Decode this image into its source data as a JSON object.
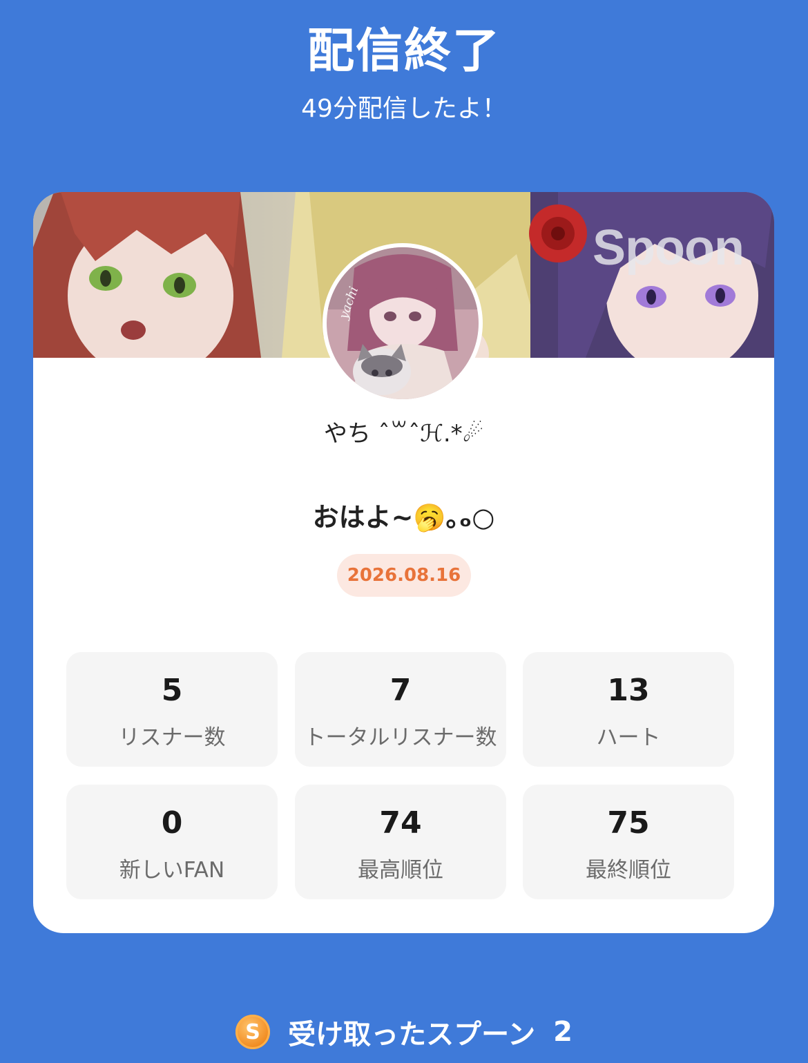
{
  "header": {
    "title": "配信終了",
    "subtitle": "49分配信したよ！"
  },
  "card": {
    "banner_watermark": "Spoon",
    "avatar_signature": "yachi",
    "username": "やち ˆ꒳ˆℋ.*☄",
    "live_title": "おはよ~🥱｡ₒ○",
    "date": "2026.08.16",
    "stats": [
      {
        "value": "5",
        "label": "リスナー数"
      },
      {
        "value": "7",
        "label": "トータルリスナー数"
      },
      {
        "value": "13",
        "label": "ハート"
      },
      {
        "value": "0",
        "label": "新しいFAN"
      },
      {
        "value": "74",
        "label": "最高順位"
      },
      {
        "value": "75",
        "label": "最終順位"
      }
    ]
  },
  "footer": {
    "coin_letter": "S",
    "spoons_label": "受け取ったスプーン",
    "spoons_count": "2"
  },
  "colors": {
    "background": "#3f7ad9",
    "card": "#ffffff",
    "stat_box": "#f5f5f5",
    "date_pill_bg": "#fce8e1",
    "date_pill_text": "#e8733a",
    "coin": "#f0891e"
  },
  "icons": {
    "coin": "spoon-coin-icon"
  }
}
